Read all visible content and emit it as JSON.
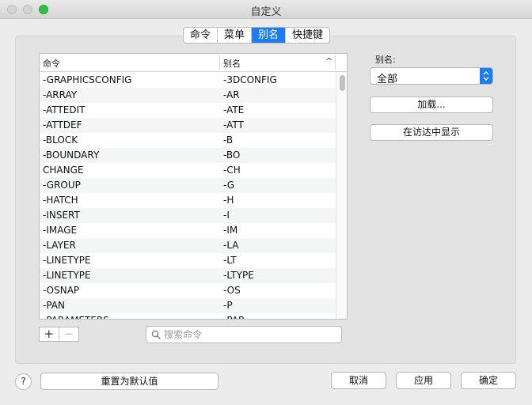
{
  "window": {
    "title": "自定义"
  },
  "tabs": [
    {
      "label": "命令",
      "active": false
    },
    {
      "label": "菜单",
      "active": false
    },
    {
      "label": "别名",
      "active": true
    },
    {
      "label": "快捷键",
      "active": false
    }
  ],
  "table": {
    "headers": {
      "command": "命令",
      "alias": "别名",
      "sort_indicator": "^"
    },
    "rows": [
      {
        "command": "-GRAPHICSCONFIG",
        "alias": "-3DCONFIG"
      },
      {
        "command": "-ARRAY",
        "alias": "-AR"
      },
      {
        "command": "-ATTEDIT",
        "alias": "-ATE"
      },
      {
        "command": "-ATTDEF",
        "alias": "-ATT"
      },
      {
        "command": "-BLOCK",
        "alias": "-B"
      },
      {
        "command": "-BOUNDARY",
        "alias": "-BO"
      },
      {
        "command": "CHANGE",
        "alias": "-CH"
      },
      {
        "command": "-GROUP",
        "alias": "-G"
      },
      {
        "command": "-HATCH",
        "alias": "-H"
      },
      {
        "command": "-INSERT",
        "alias": "-I"
      },
      {
        "command": "-IMAGE",
        "alias": "-IM"
      },
      {
        "command": "-LAYER",
        "alias": "-LA"
      },
      {
        "command": "-LINETYPE",
        "alias": "-LT"
      },
      {
        "command": "-LINETYPE",
        "alias": "-LTYPE"
      },
      {
        "command": "-OSNAP",
        "alias": "-OS"
      },
      {
        "command": "-PAN",
        "alias": "-P"
      },
      {
        "command": "-PARAMETERS",
        "alias": "-PAR"
      }
    ]
  },
  "list_controls": {
    "add": "+",
    "remove": "−"
  },
  "search": {
    "placeholder": "搜索命令",
    "value": ""
  },
  "sidebar": {
    "filter_label": "别名:",
    "filter_value": "全部",
    "load_button": "加载...",
    "show_in_finder_button": "在访达中显示"
  },
  "footer": {
    "help": "?",
    "reset_button": "重置为默认值",
    "cancel_button": "取消",
    "apply_button": "应用",
    "ok_button": "确定"
  },
  "colors": {
    "accent": "#1c7cf2",
    "zoom_button": "#2fc043"
  }
}
